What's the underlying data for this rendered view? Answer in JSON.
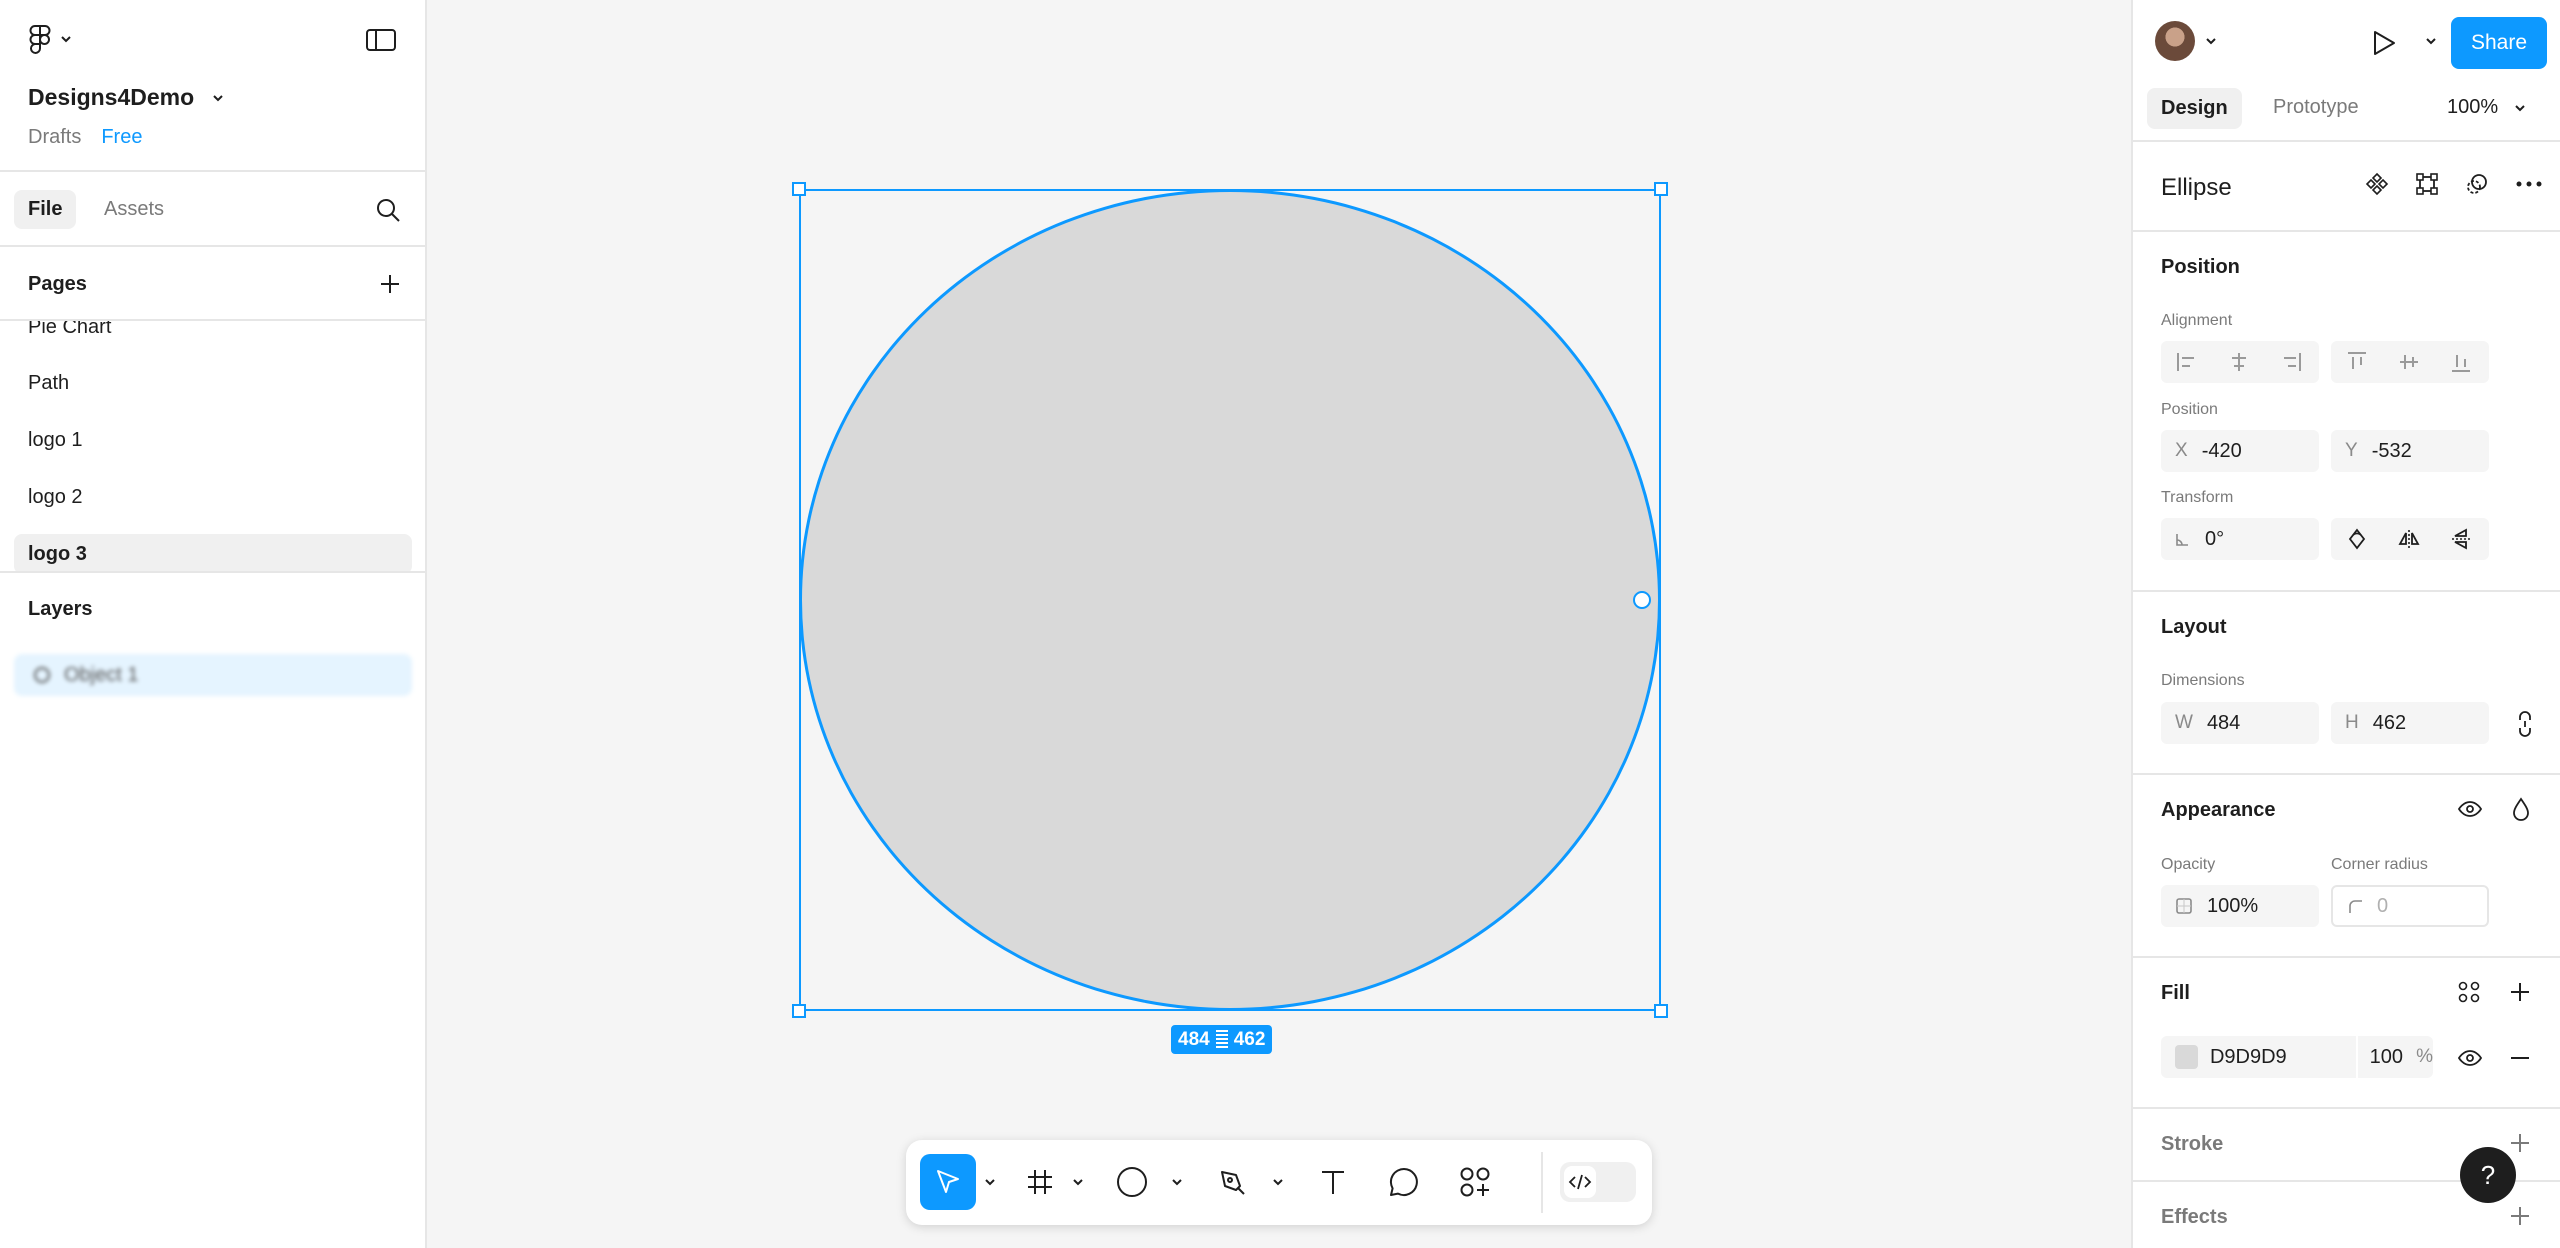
{
  "file": {
    "name": "Designs4Demo",
    "location": "Drafts",
    "plan": "Free"
  },
  "left_tabs": {
    "file": "File",
    "assets": "Assets"
  },
  "pages": {
    "title": "Pages",
    "items": [
      "Pie Chart",
      "Path",
      "logo 1",
      "logo 2",
      "logo 3"
    ],
    "active": "logo 3"
  },
  "layers": {
    "title": "Layers",
    "items": [
      "Object 1"
    ]
  },
  "canvas": {
    "selection": {
      "width": "484",
      "height": "462"
    }
  },
  "toolbar": {
    "tools": [
      "move-tool",
      "frame-tool",
      "ellipse-tool",
      "pen-tool",
      "text-tool",
      "comment-tool",
      "actions-tool",
      "dev-mode-toggle"
    ]
  },
  "header": {
    "share_label": "Share"
  },
  "right_tabs": {
    "design": "Design",
    "prototype": "Prototype",
    "zoom": "100%"
  },
  "properties": {
    "layer_type": "Ellipse",
    "position": {
      "title": "Position",
      "alignment_label": "Alignment",
      "position_label": "Position",
      "x_label": "X",
      "x": "-420",
      "y_label": "Y",
      "y": "-532",
      "transform_label": "Transform",
      "rotation": "0°"
    },
    "layout": {
      "title": "Layout",
      "dimensions_label": "Dimensions",
      "w_label": "W",
      "w": "484",
      "h_label": "H",
      "h": "462"
    },
    "appearance": {
      "title": "Appearance",
      "opacity_label": "Opacity",
      "opacity": "100%",
      "corner_label": "Corner radius",
      "corner": "0"
    },
    "fill": {
      "title": "Fill",
      "hex": "D9D9D9",
      "opacity": "100",
      "unit": "%"
    },
    "stroke": {
      "title": "Stroke"
    },
    "effects": {
      "title": "Effects"
    }
  },
  "help_label": "?",
  "colors": {
    "accent": "#0d99ff",
    "fill": "#D9D9D9"
  }
}
